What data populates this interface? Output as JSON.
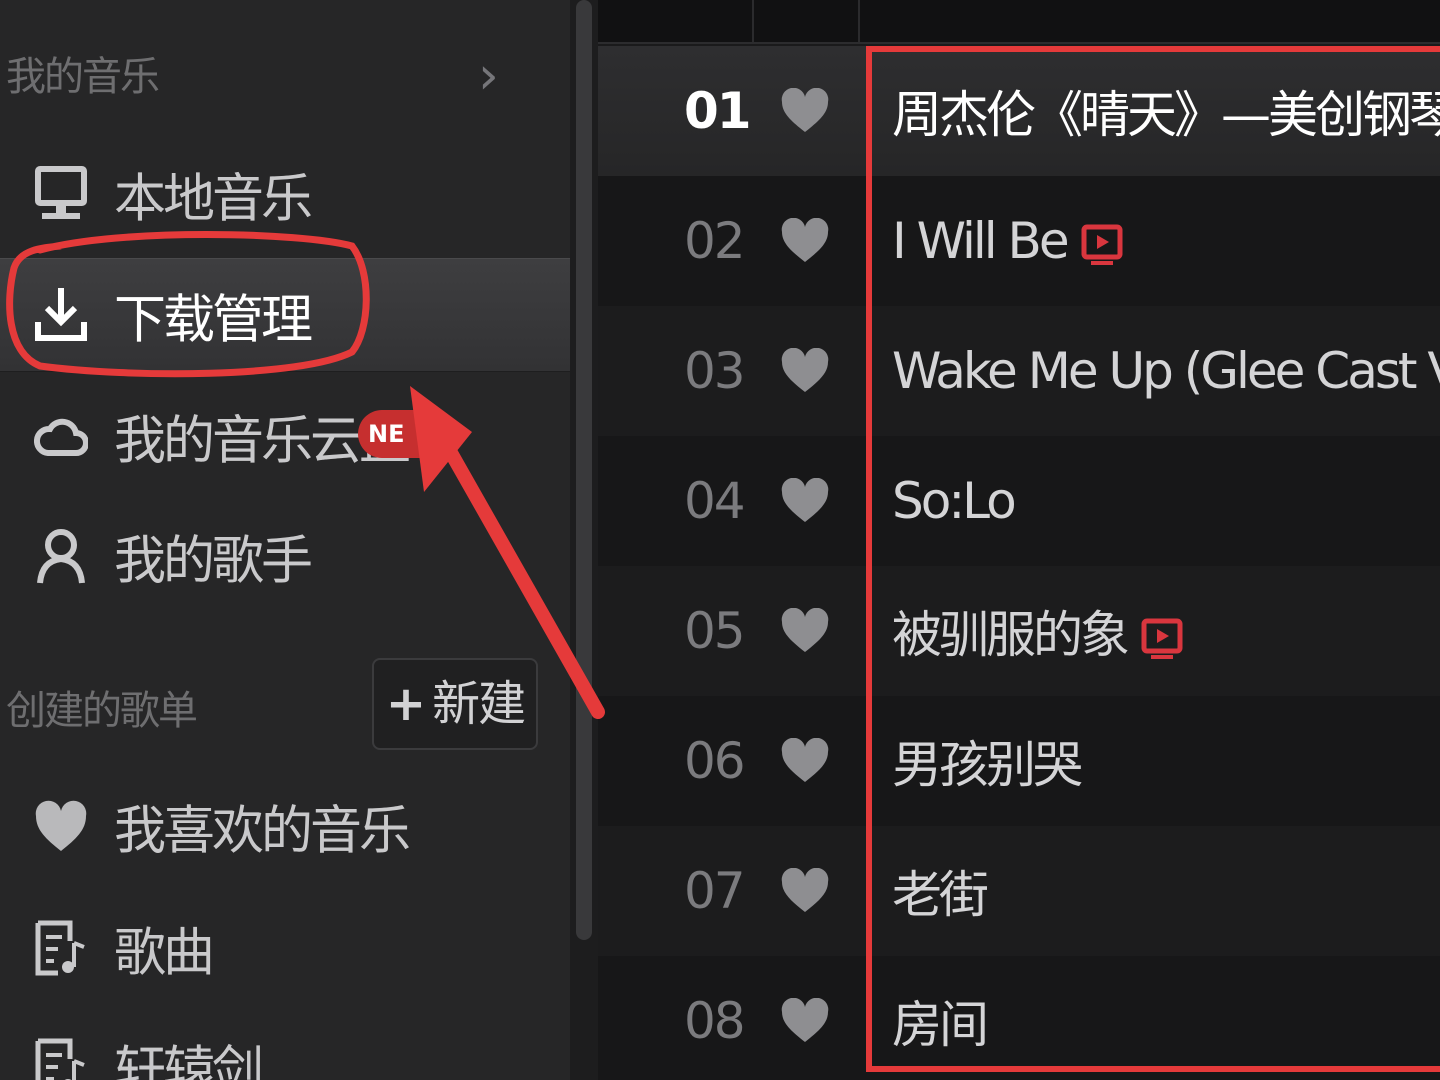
{
  "sidebar": {
    "my_music": {
      "title": "我的音乐",
      "arrow": "›",
      "items": [
        {
          "label": "本地音乐",
          "icon": "monitor-icon"
        },
        {
          "label": "下载管理",
          "icon": "download-icon",
          "active": true
        },
        {
          "label": "我的音乐云盘",
          "icon": "cloud-icon",
          "badge": "NE"
        },
        {
          "label": "我的歌手",
          "icon": "user-icon"
        }
      ]
    },
    "playlists": {
      "title": "创建的歌单",
      "new_button": {
        "plus": "+",
        "label": "新建"
      },
      "items": [
        {
          "label": "我喜欢的音乐",
          "icon": "heart-icon"
        },
        {
          "label": "歌曲",
          "icon": "playlist-icon"
        },
        {
          "label": "轩辕剑",
          "icon": "playlist-icon"
        }
      ]
    }
  },
  "songs": [
    {
      "num": "01",
      "title": "周杰伦《晴天》—美创钢琴版",
      "playing": true
    },
    {
      "num": "02",
      "title": "I Will Be",
      "mv": true
    },
    {
      "num": "03",
      "title": "Wake Me Up (Glee Cast Version"
    },
    {
      "num": "04",
      "title": "So:Lo"
    },
    {
      "num": "05",
      "title": "被驯服的象",
      "mv": true
    },
    {
      "num": "06",
      "title": "男孩别哭"
    },
    {
      "num": "07",
      "title": "老街"
    },
    {
      "num": "08",
      "title": "房间"
    }
  ],
  "colors": {
    "annotation": "#e53a3a",
    "badge": "#c62f2f",
    "mv_icon": "#d9363e"
  }
}
